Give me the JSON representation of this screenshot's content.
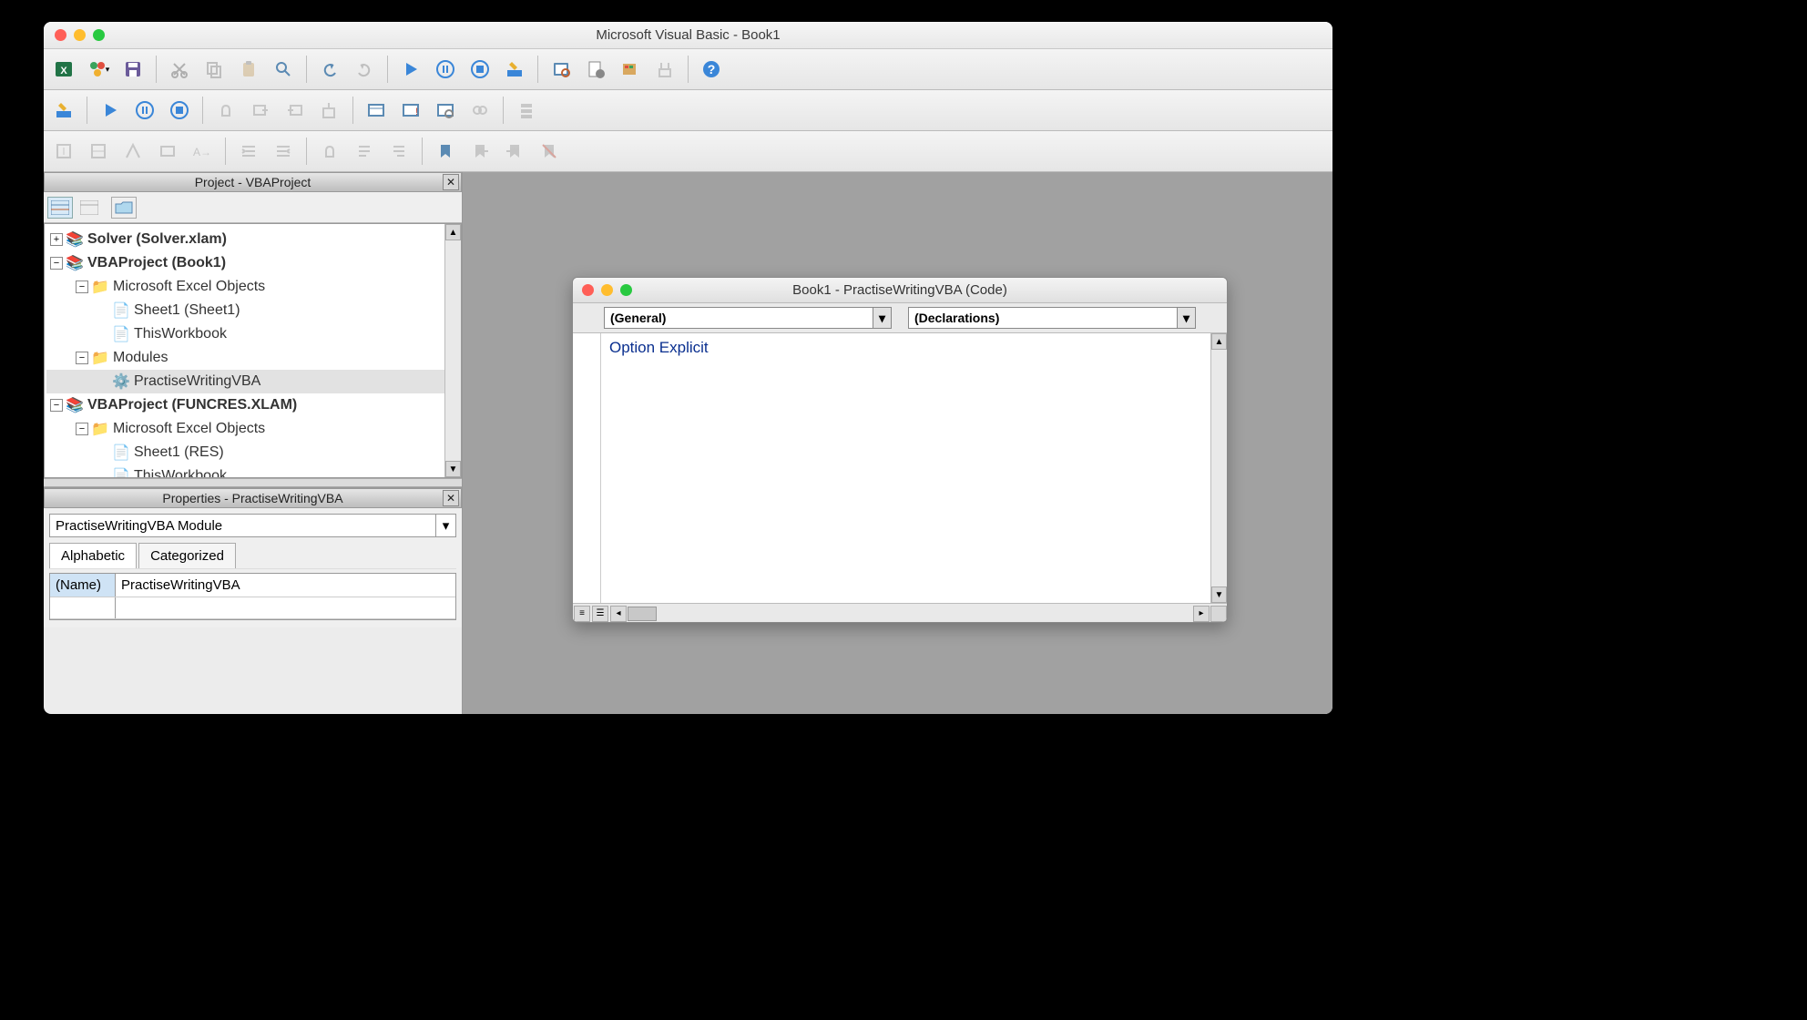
{
  "window": {
    "title": "Microsoft Visual Basic - Book1"
  },
  "project_pane": {
    "title": "Project - VBAProject",
    "tree": {
      "solver": "Solver (Solver.xlam)",
      "book1": "VBAProject (Book1)",
      "excel_objects": "Microsoft Excel Objects",
      "sheet1": "Sheet1 (Sheet1)",
      "thiswb": "ThisWorkbook",
      "modules": "Modules",
      "module1": "PractiseWritingVBA",
      "funcres": "VBAProject (FUNCRES.XLAM)",
      "sheet1res": "Sheet1 (RES)",
      "thiswb2": "ThisWorkbook"
    }
  },
  "properties_pane": {
    "title": "Properties - PractiseWritingVBA",
    "combo": "PractiseWritingVBA  Module",
    "tab_alpha": "Alphabetic",
    "tab_cat": "Categorized",
    "row_key": "(Name)",
    "row_val": "PractiseWritingVBA"
  },
  "code_window": {
    "title": "Book1 - PractiseWritingVBA (Code)",
    "combo_left": "(General)",
    "combo_right": "(Declarations)",
    "code": "Option Explicit"
  }
}
